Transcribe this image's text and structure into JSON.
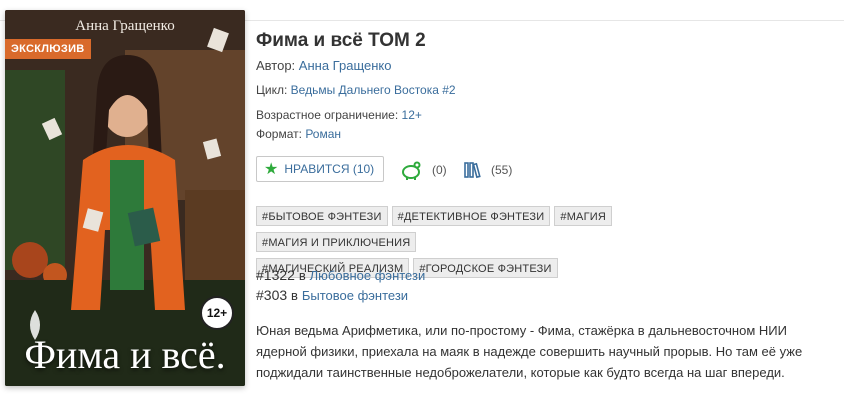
{
  "cover": {
    "author_text": "Анна Гращенко",
    "badge": "ЭКСКЛЮЗИВ",
    "age": "12+",
    "title_text": "Фима и всё."
  },
  "book": {
    "title": "Фима и всё ТОМ 2",
    "author_label": "Автор:",
    "author": "Анна Гращенко",
    "cycle_label": "Цикл:",
    "cycle": "Ведьмы Дальнего Востока #2",
    "age_label": "Возрастное ограничение:",
    "age": "12+",
    "format_label": "Формат:",
    "format": "Роман"
  },
  "actions": {
    "like_label": "НРАВИТСЯ (10)",
    "reward_count": "(0)",
    "library_count": "(55)"
  },
  "tags": [
    "#БЫТОВОЕ ФЭНТЕЗИ",
    "#ДЕТЕКТИВНОЕ ФЭНТЕЗИ",
    "#МАГИЯ",
    "#МАГИЯ И ПРИКЛЮЧЕНИЯ",
    "#МАГИЧЕСКИЙ РЕАЛИЗМ",
    "#ГОРОДСКОЕ ФЭНТЕЗИ"
  ],
  "rankings": [
    {
      "rank": "#1322",
      "in": "в",
      "genre": "Любовное фэнтези"
    },
    {
      "rank": "#303",
      "in": "в",
      "genre": "Бытовое фэнтези"
    }
  ],
  "description": "Юная ведьма Арифметика, или по-простому - Фима, стажёрка в дальневосточном НИИ ядерной физики, приехала на маяк в надежде совершить научный прорыв. Но там её уже поджидали таинственные недоброжелатели, которые как будто всегда на шаг впереди.",
  "colors": {
    "link": "#3a6d9c",
    "badge": "#d96a2b",
    "like_star": "#2eaa3c"
  }
}
